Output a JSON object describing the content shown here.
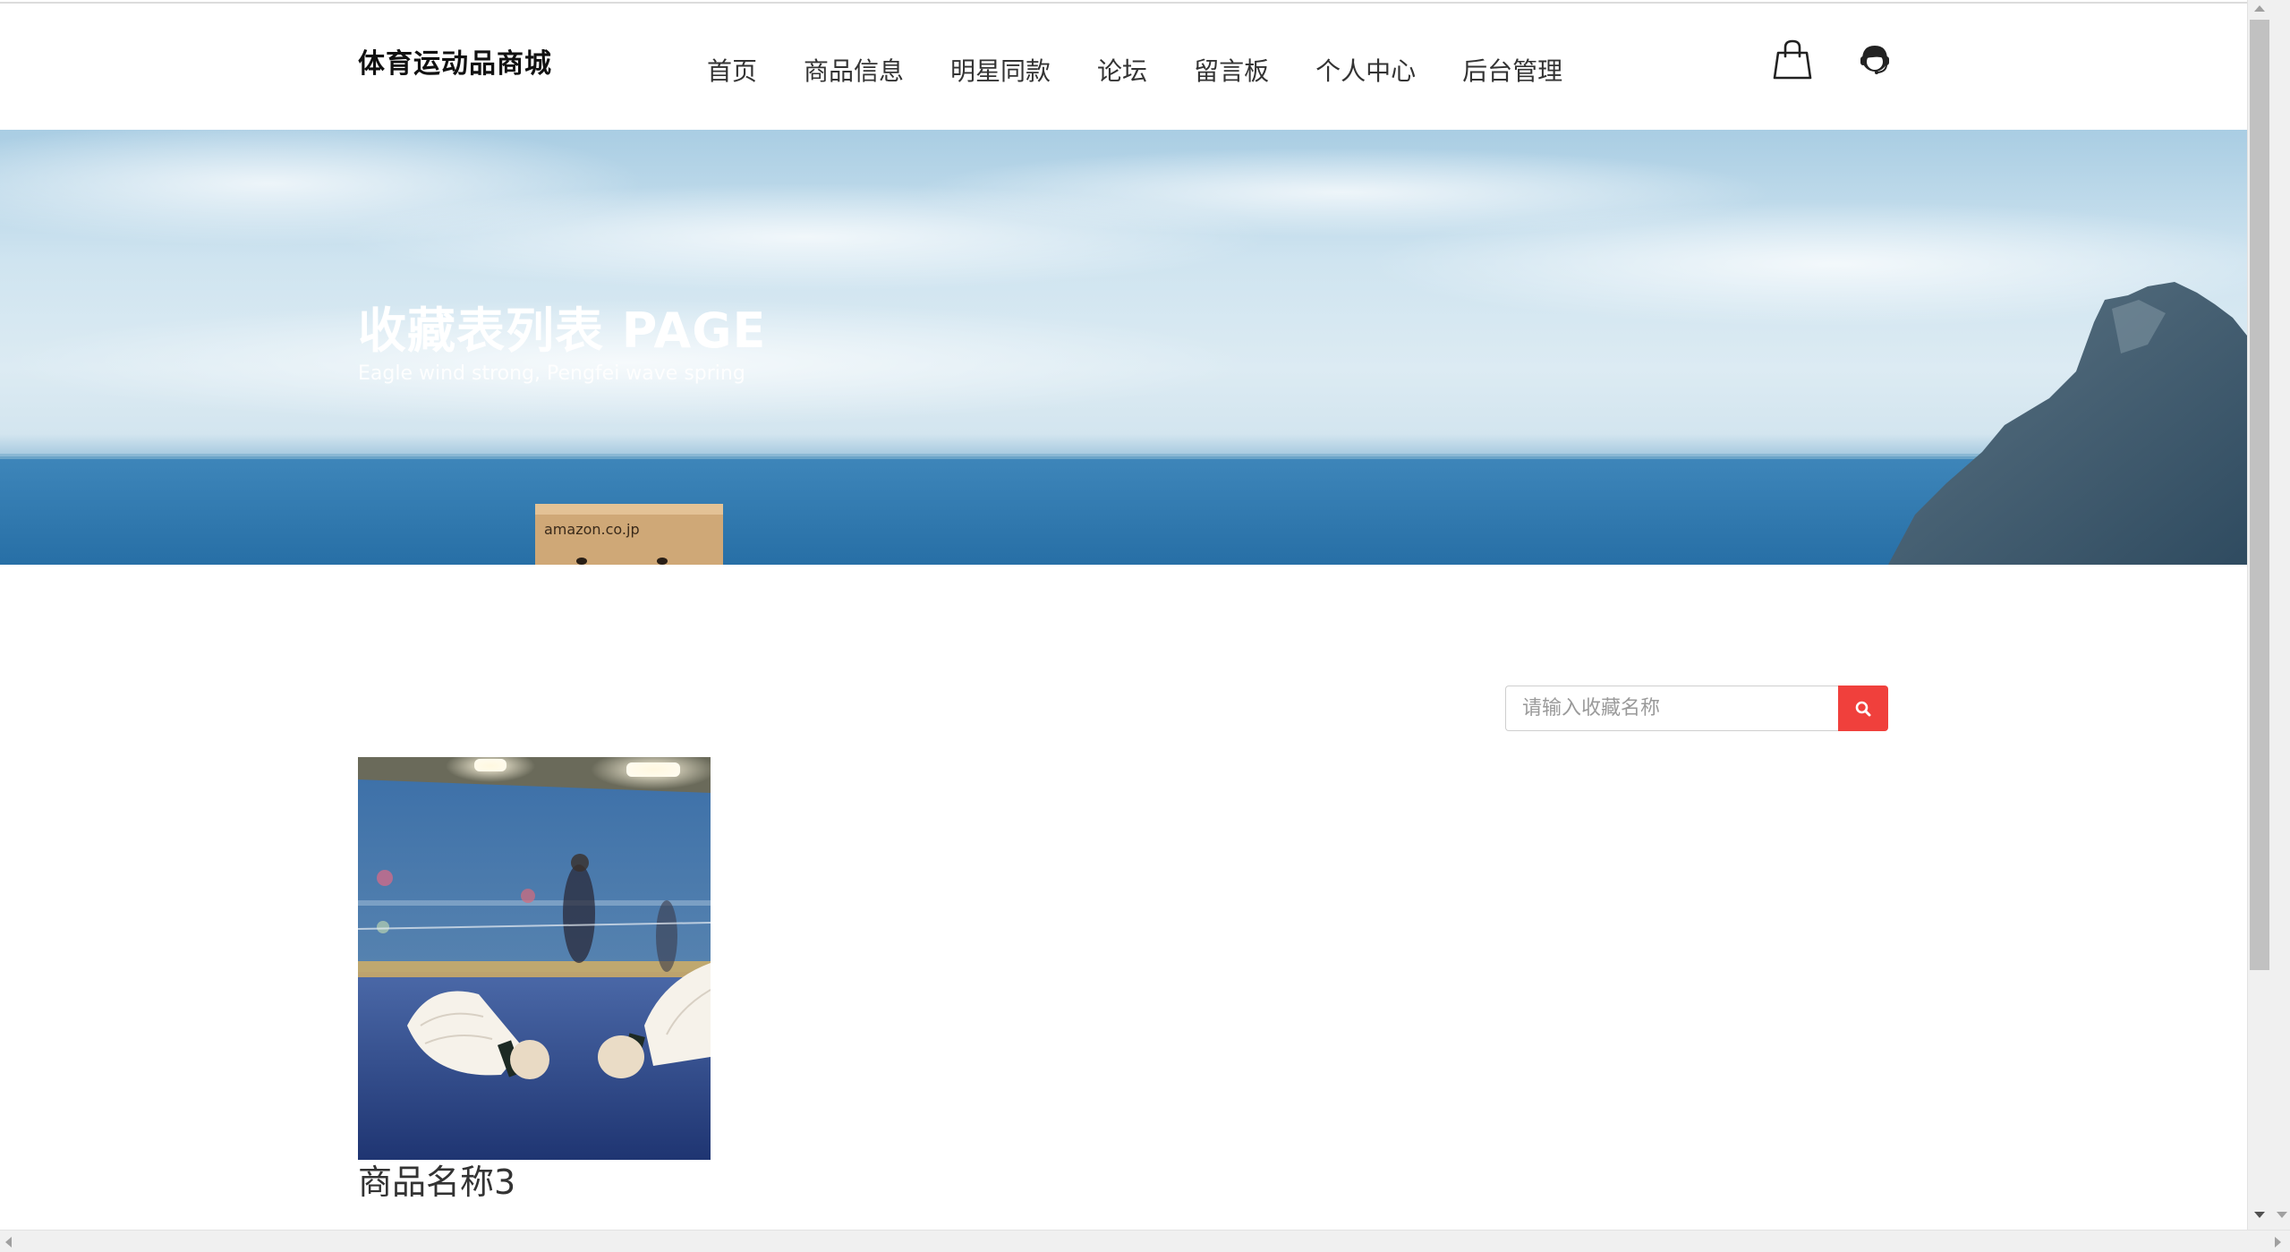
{
  "header": {
    "brand": "体育运动品商城",
    "nav": [
      {
        "label": "首页"
      },
      {
        "label": "商品信息"
      },
      {
        "label": "明星同款"
      },
      {
        "label": "论坛"
      },
      {
        "label": "留言板"
      },
      {
        "label": "个人中心"
      },
      {
        "label": "后台管理"
      }
    ],
    "icons": [
      "shopping-bag-icon",
      "customer-service-icon"
    ]
  },
  "banner": {
    "title": "收藏表列表 PAGE",
    "subtitle": "Eagle wind strong, Pengfei wave spring",
    "box_label": "amazon.co.jp"
  },
  "search": {
    "placeholder": "请输入收藏名称",
    "value": "",
    "icon": "search-icon"
  },
  "products": [
    {
      "name": "商品名称3",
      "image": "badminton-shuttlecocks-photo"
    }
  ],
  "colors": {
    "accent": "#f0403c",
    "text": "#333333",
    "brand_text": "#111111"
  }
}
